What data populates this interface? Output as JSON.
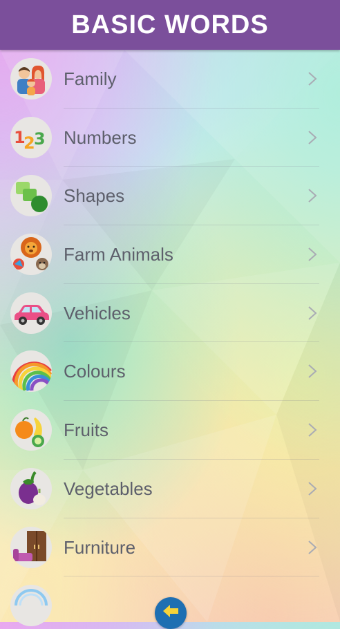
{
  "header": {
    "title": "BASIC WORDS"
  },
  "categories": [
    {
      "label": "Family",
      "icon": "family-icon"
    },
    {
      "label": "Numbers",
      "icon": "numbers-icon"
    },
    {
      "label": "Shapes",
      "icon": "shapes-icon"
    },
    {
      "label": "Farm Animals",
      "icon": "farm-animals-icon"
    },
    {
      "label": "Vehicles",
      "icon": "car-icon"
    },
    {
      "label": "Colours",
      "icon": "rainbow-icon"
    },
    {
      "label": "Fruits",
      "icon": "fruits-icon"
    },
    {
      "label": "Vegetables",
      "icon": "vegetables-icon"
    },
    {
      "label": "Furniture",
      "icon": "furniture-icon"
    }
  ],
  "footer": {
    "back_icon": "back-arrow-icon"
  },
  "colors": {
    "header": "#7b4f9b",
    "back_button": "#1e6fb2",
    "label_text": "#5d5f6b"
  }
}
